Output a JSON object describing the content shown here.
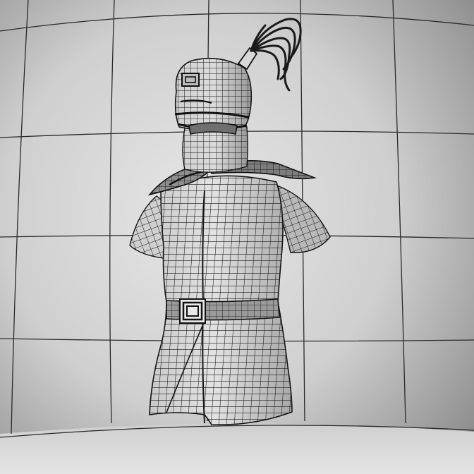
{
  "scene": {
    "subject": "armor-bust-wireframe",
    "colors": {
      "backdrop_light": "#e2e2e2",
      "backdrop_mid": "#c9c9c9",
      "backdrop_dark": "#8f8f8f",
      "floor": "#d7d7d7",
      "grid_line": "#2a2a2a",
      "mesh_fill_light": "#dedede",
      "mesh_fill_dark": "#9c9c9c",
      "mesh_wire": "#151515",
      "plume": "#1a1a1a"
    }
  }
}
